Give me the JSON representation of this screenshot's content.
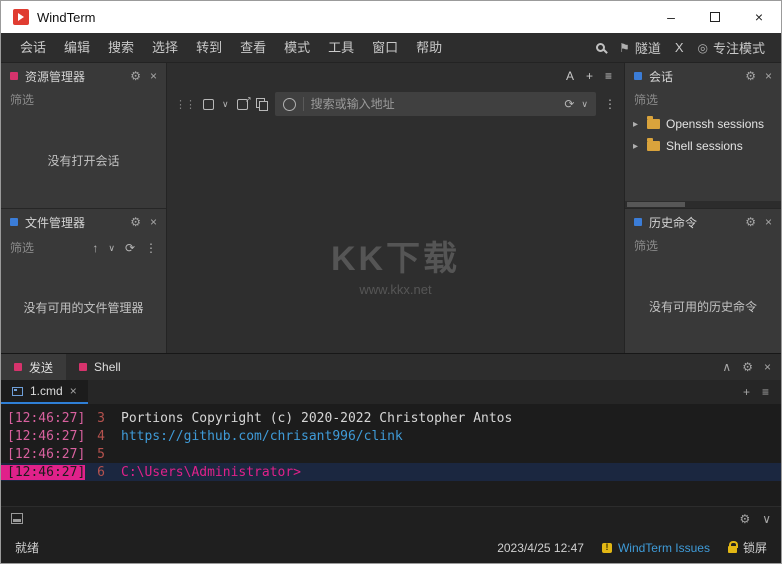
{
  "window": {
    "title": "WindTerm"
  },
  "menu": {
    "items": [
      "会话",
      "编辑",
      "搜索",
      "选择",
      "转到",
      "查看",
      "模式",
      "工具",
      "窗口",
      "帮助"
    ],
    "tunnel": "隧道",
    "x_label": "X",
    "focus_mode": "专注模式"
  },
  "icons": {
    "minimize": "–",
    "close": "×",
    "gear": "⚙",
    "chevron_down": "∨",
    "chevron_up": "∧",
    "dots": "⋮",
    "refresh": "⟳",
    "arrow_up": "↑",
    "tree_arrow": "▸",
    "plus": "+",
    "menu": "≡",
    "letter_a": "A",
    "flag": "⚑",
    "target": "◎",
    "grip": "⋮⋮"
  },
  "panels": {
    "explorer": {
      "title": "资源管理器",
      "filter": "筛选",
      "empty": "没有打开会话"
    },
    "file_manager": {
      "title": "文件管理器",
      "filter": "筛选",
      "empty": "没有可用的文件管理器"
    },
    "sessions": {
      "title": "会话",
      "filter": "筛选",
      "items": [
        {
          "label": "Openssh sessions"
        },
        {
          "label": "Shell sessions"
        }
      ]
    },
    "history": {
      "title": "历史命令",
      "filter": "筛选",
      "empty": "没有可用的历史命令"
    }
  },
  "address_bar": {
    "placeholder": "搜索或输入地址"
  },
  "watermark": {
    "line1": "KK下载",
    "line2": "www.kkx.net"
  },
  "bottom": {
    "send_tab": "发送",
    "shell_tab": "Shell",
    "cmd_tab": "1.cmd",
    "terminal": {
      "lines": [
        {
          "time": "[12:46:27]",
          "num": "3",
          "text": "Portions Copyright (c) 2020-2022 Christopher Antos"
        },
        {
          "time": "[12:46:27]",
          "num": "4",
          "text": "https://github.com/chrisant996/clink"
        },
        {
          "time": "[12:46:27]",
          "num": "5",
          "text": ""
        },
        {
          "time": "[12:46:27]",
          "num": "6",
          "text": "C:\\Users\\Administrator>"
        }
      ]
    }
  },
  "status": {
    "ready": "就绪",
    "datetime": "2023/4/25 12:47",
    "issues": "WindTerm Issues",
    "lock": "锁屏"
  },
  "colors": {
    "accent_pink": "#e0218a",
    "link_blue": "#3f9bd8",
    "folder_yellow": "#d9a33c"
  }
}
